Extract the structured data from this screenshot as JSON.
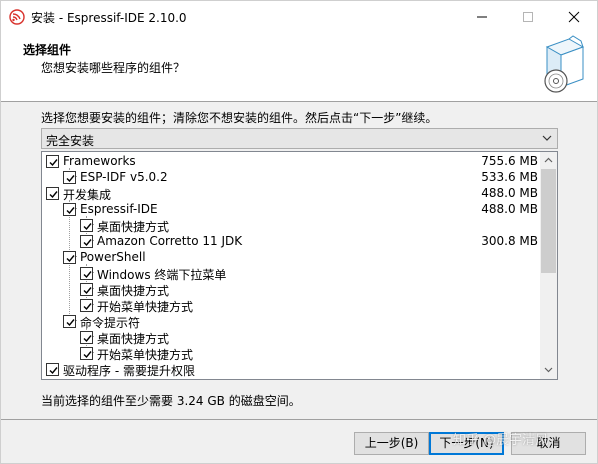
{
  "window": {
    "title": "安装 - Espressif-IDE 2.10.0",
    "icons": {
      "app": "espressif-icon",
      "minimize": "minimize-icon",
      "maximize": "maximize-icon",
      "close": "close-icon"
    }
  },
  "header": {
    "title": "选择组件",
    "subtitle": "您想安装哪些程序的组件？",
    "graphic": "installer-box-disc-graphic"
  },
  "instruction": "选择您想要安装的组件；清除您不想安装的组件。然后点击“下一步”继续。",
  "install_type": {
    "selected": "完全安装"
  },
  "components": [
    {
      "label": "Frameworks",
      "size": "755.6 MB",
      "checked": true
    },
    {
      "label": "ESP-IDF v5.0.2",
      "size": "533.6 MB",
      "checked": true
    },
    {
      "label": "开发集成",
      "size": "488.0 MB",
      "checked": true
    },
    {
      "label": "Espressif-IDE",
      "size": "488.0 MB",
      "checked": true
    },
    {
      "label": "桌面快捷方式",
      "size": "",
      "checked": true
    },
    {
      "label": "Amazon Corretto 11 JDK",
      "size": "300.8 MB",
      "checked": true
    },
    {
      "label": "PowerShell",
      "size": "",
      "checked": true
    },
    {
      "label": "Windows 终端下拉菜单",
      "size": "",
      "checked": true
    },
    {
      "label": "桌面快捷方式",
      "size": "",
      "checked": true
    },
    {
      "label": "开始菜单快捷方式",
      "size": "",
      "checked": true
    },
    {
      "label": "命令提示符",
      "size": "",
      "checked": true
    },
    {
      "label": "桌面快捷方式",
      "size": "",
      "checked": true
    },
    {
      "label": "开始菜单快捷方式",
      "size": "",
      "checked": true
    },
    {
      "label": "驱动程序 - 需要提升权限",
      "size": "",
      "checked": true
    }
  ],
  "space_info": "当前选择的组件至少需要 3.24 GB 的磁盘空间。",
  "buttons": {
    "back": "上一步(B)",
    "next": "下一步(N)",
    "cancel": "取消"
  },
  "watermark": "知乎 @晨宇清风",
  "colors": {
    "accent": "#0078d7",
    "scroll_thumb": "#cdcdcd"
  }
}
